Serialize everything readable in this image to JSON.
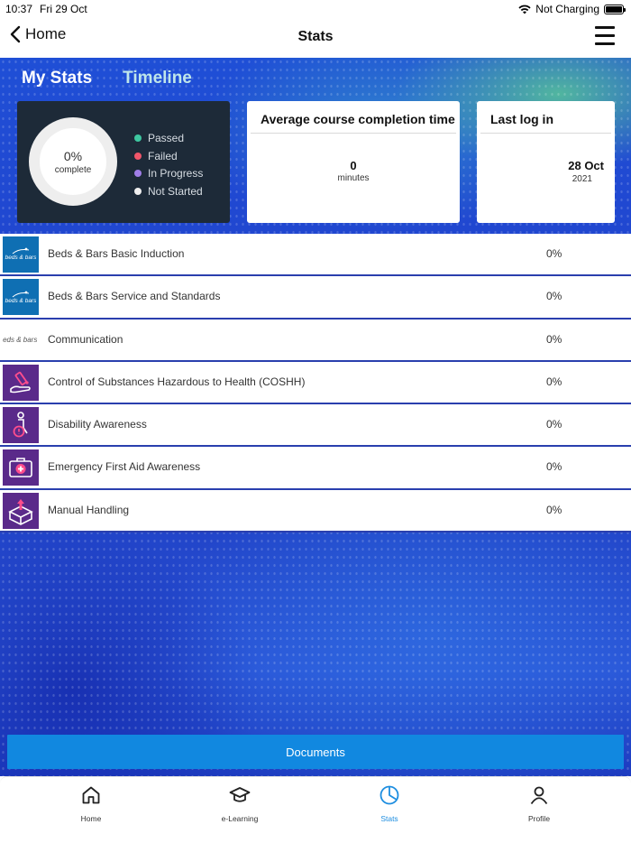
{
  "status_bar": {
    "time": "10:37",
    "date": "Fri 29 Oct",
    "charging": "Not Charging",
    "icons": [
      "wifi-icon",
      "battery-icon"
    ]
  },
  "nav": {
    "back_label": "Home",
    "title": "Stats",
    "icons": [
      "chevron-left-icon",
      "hamburger-menu-icon"
    ]
  },
  "tabs": [
    {
      "label": "My Stats",
      "active": true
    },
    {
      "label": "Timeline",
      "active": false
    }
  ],
  "progress": {
    "percent_label": "0%",
    "complete_label": "complete",
    "complete_fraction": 0,
    "legend": [
      {
        "label": "Passed",
        "color": "#3ec7a0"
      },
      {
        "label": "Failed",
        "color": "#f0566a"
      },
      {
        "label": "In Progress",
        "color": "#a07ee8"
      },
      {
        "label": "Not Started",
        "color": "#eeeeee"
      }
    ]
  },
  "avg_completion": {
    "title": "Average course completion time",
    "value": "0",
    "unit": "minutes"
  },
  "last_login": {
    "title": "Last log in",
    "date": "28 Oct",
    "year": "2021"
  },
  "courses": [
    {
      "name": "Beds & Bars Basic Induction",
      "percent": "0%",
      "thumb": "beds-and-bars-logo",
      "thumb_text": "beds & bars"
    },
    {
      "name": "Beds & Bars Service and Standards",
      "percent": "0%",
      "thumb": "beds-and-bars-logo",
      "thumb_text": "beds & bars"
    },
    {
      "name": "Communication",
      "percent": "0%",
      "thumb": "beds-and-bars-logo-light",
      "thumb_text": "beds & bars"
    },
    {
      "name": "Control of Substances Hazardous to Health (COSHH)",
      "percent": "0%",
      "thumb": "coshh-icon",
      "thumb_text": ""
    },
    {
      "name": "Disability Awareness",
      "percent": "0%",
      "thumb": "disability-icon",
      "thumb_text": ""
    },
    {
      "name": "Emergency First Aid Awareness",
      "percent": "0%",
      "thumb": "first-aid-icon",
      "thumb_text": ""
    },
    {
      "name": "Manual Handling",
      "percent": "0%",
      "thumb": "manual-handling-icon",
      "thumb_text": ""
    }
  ],
  "documents_label": "Documents",
  "tab_bar": [
    {
      "label": "Home",
      "icon": "home-icon",
      "active": false
    },
    {
      "label": "e-Learning",
      "icon": "graduation-cap-icon",
      "active": false
    },
    {
      "label": "Stats",
      "icon": "pie-chart-icon",
      "active": true
    },
    {
      "label": "Profile",
      "icon": "person-icon",
      "active": false
    }
  ],
  "colors": {
    "accent": "#1e8ee0",
    "card_dark": "#1d2a38",
    "documents_button": "#1188e0",
    "row_separator": "#2a3fae"
  }
}
